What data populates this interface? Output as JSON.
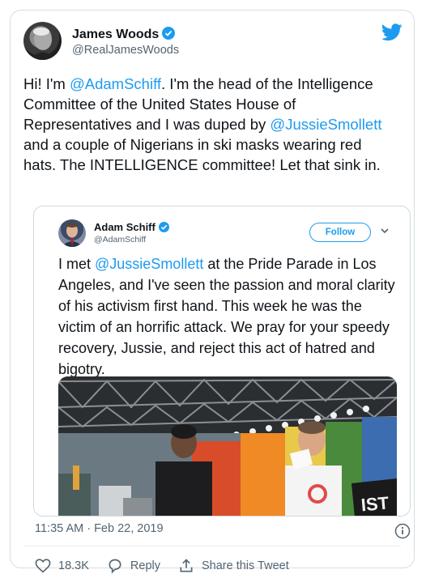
{
  "author": {
    "name": "James Woods",
    "handle": "@RealJamesWoods"
  },
  "tweet": {
    "text_intro": "Hi! I'm ",
    "mention_1": "@AdamSchiff",
    "text_mid": ". I'm the head of the Intelligence Committee of the United States House of Representatives and I was duped by ",
    "mention_2": "@JussieSmollett",
    "text_end": " and a couple of Nigerians in ski masks wearing red hats. The INTELLIGENCE committee! Let that sink in."
  },
  "quoted": {
    "name": "Adam Schiff",
    "handle": "@AdamSchiff",
    "follow_label": "Follow",
    "text_intro": "I met ",
    "mention": "@JussieSmollett",
    "text_rest": " at the Pride Parade in Los Angeles, and I've seen the passion and moral clarity of his activism first hand. This week he was the victim of an horrific attack. We pray for your speedy recovery, Jussie, and reject this act of hatred and bigotry.",
    "photo_sign_text": "IST"
  },
  "meta": {
    "timestamp": "11:35 AM · Feb 22, 2019"
  },
  "actions": {
    "likes": "18.3K",
    "reply_label": "Reply",
    "share_label": "Share this Tweet"
  },
  "colors": {
    "accent": "#1d9bf0",
    "text": "#0f1419",
    "secondary": "#536471",
    "border": "#cfd9de"
  },
  "icons": [
    "twitter-bird-icon",
    "verified-badge-icon",
    "chevron-down-icon",
    "info-icon",
    "heart-icon",
    "reply-icon",
    "share-icon"
  ]
}
